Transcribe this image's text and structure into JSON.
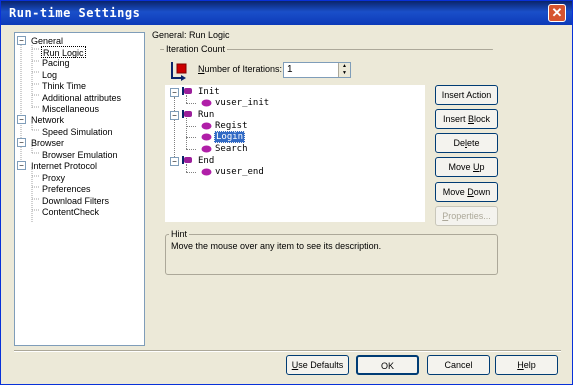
{
  "window": {
    "title": "Run-time Settings",
    "close_glyph": "✕"
  },
  "nav_tree": [
    {
      "label": "General",
      "pm": "−"
    },
    {
      "label": "Run Logic",
      "selected": true
    },
    {
      "label": "Pacing"
    },
    {
      "label": "Log"
    },
    {
      "label": "Think Time"
    },
    {
      "label": "Additional attributes"
    },
    {
      "label": "Miscellaneous"
    },
    {
      "label": "Network",
      "pm": "−"
    },
    {
      "label": "Speed Simulation"
    },
    {
      "label": "Browser",
      "pm": "−"
    },
    {
      "label": "Browser Emulation"
    },
    {
      "label": "Internet Protocol",
      "pm": "−"
    },
    {
      "label": "Proxy"
    },
    {
      "label": "Preferences"
    },
    {
      "label": "Download Filters"
    },
    {
      "label": "ContentCheck"
    }
  ],
  "panel": {
    "title": "General: Run Logic",
    "iteration_group_title": "Iteration Count",
    "iterations_label_underlined": "N",
    "iterations_label_rest": "umber of Iterations:",
    "iterations_value": "1"
  },
  "script_tree": {
    "init": "Init",
    "vuser_init": "vuser_init",
    "run": "Run",
    "regist": "Regist",
    "login": "Login",
    "search": "Search",
    "end": "End",
    "vuser_end": "vuser_end",
    "expanded_glyph": "−"
  },
  "action_buttons": {
    "insert_action": "Insert Action",
    "insert_block_pre": "Insert ",
    "insert_block_u": "B",
    "insert_block_post": "lock",
    "delete_pre": "De",
    "delete_u": "l",
    "delete_post": "ete",
    "move_up_pre": "Move ",
    "move_up_u": "U",
    "move_up_post": "p",
    "move_down_pre": "Move ",
    "move_down_u": "D",
    "move_down_post": "own",
    "properties_u": "P",
    "properties_post": "roperties..."
  },
  "hint": {
    "title": "Hint",
    "text": "Move the mouse over any item to see its description."
  },
  "footer": {
    "use_defaults_u": "U",
    "use_defaults_post": "se Defaults",
    "ok": "OK",
    "cancel": "Cancel",
    "help_u": "H",
    "help_post": "elp"
  },
  "colors": {
    "title_bar": "#0a246a",
    "selection": "#316ac5",
    "window_bg": "#ece9d8",
    "close_button": "#d6542f"
  }
}
